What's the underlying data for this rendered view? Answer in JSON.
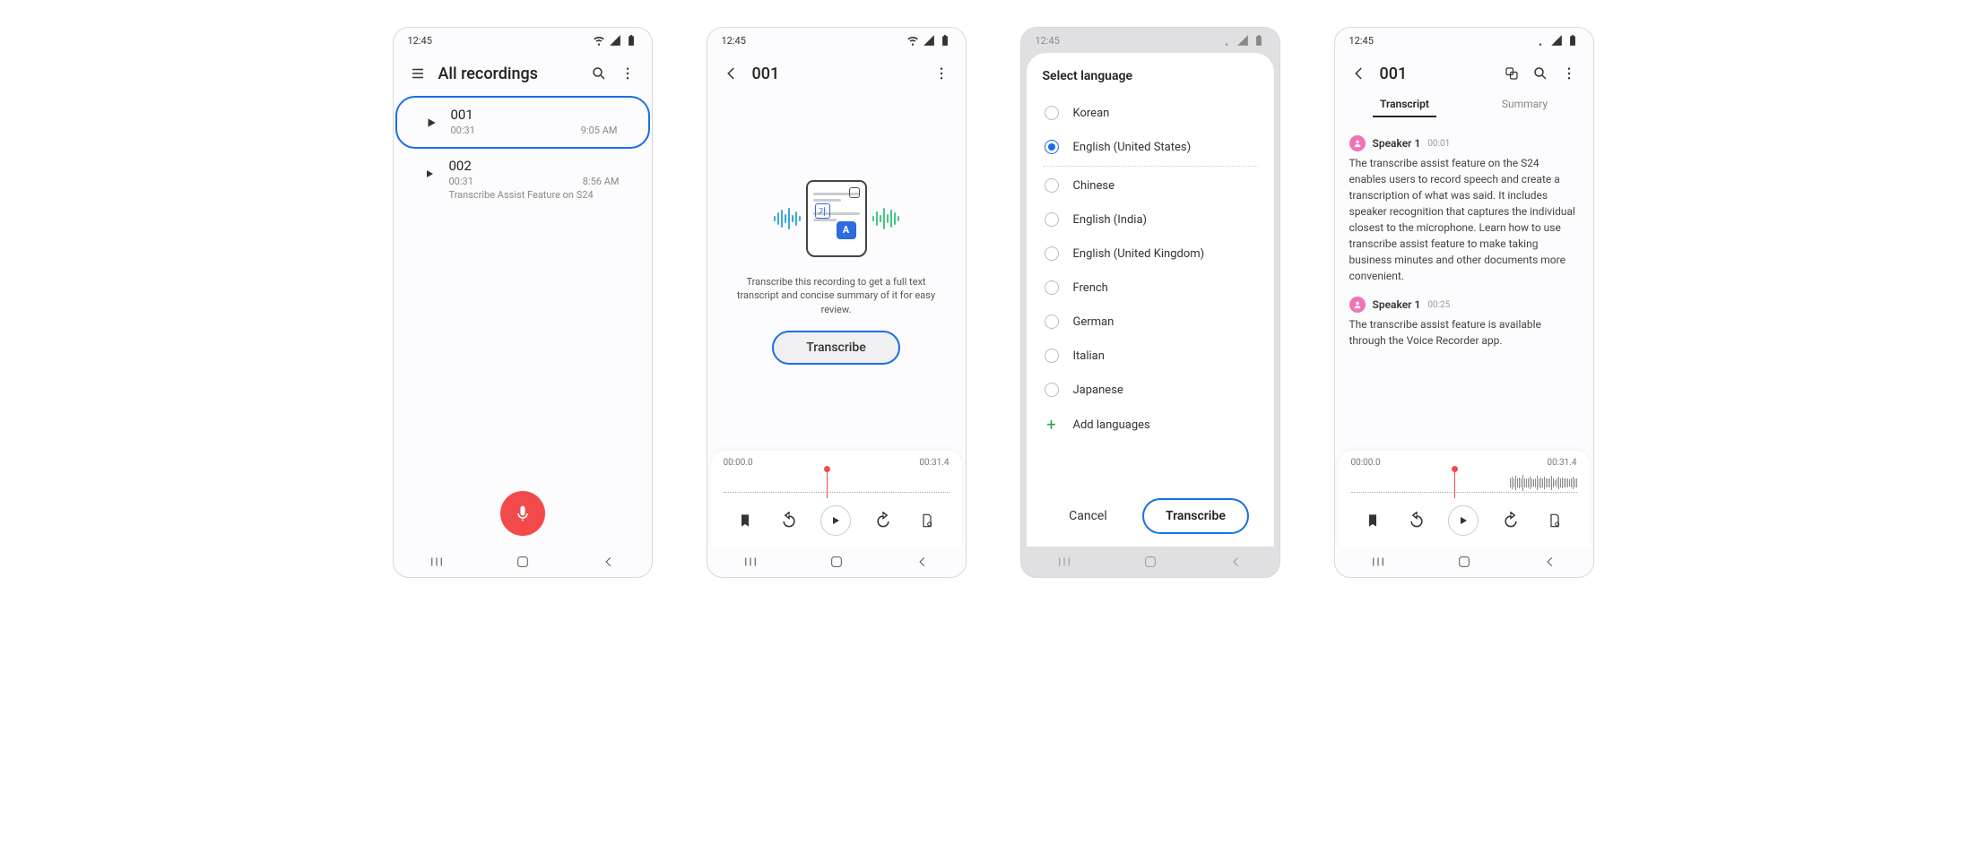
{
  "status": {
    "time": "12:45"
  },
  "screen1": {
    "title": "All recordings",
    "recordings": [
      {
        "name": "001",
        "duration": "00:31",
        "time": "9:05 AM",
        "note": ""
      },
      {
        "name": "002",
        "duration": "00:31",
        "time": "8:56 AM",
        "note": "Transcribe Assist Feature on S24"
      }
    ]
  },
  "screen2": {
    "title": "001",
    "promo_text": "Transcribe this recording to get a full text transcript and concise summary of it for easy review.",
    "button": "Transcribe",
    "time_start": "00:00.0",
    "time_end": "00:31.4"
  },
  "screen3": {
    "title": "Select language",
    "selected": "English (United States)",
    "languages_top": [
      "Korean"
    ],
    "languages": [
      "Chinese",
      "English (India)",
      "English (United Kingdom)",
      "French",
      "German",
      "Italian",
      "Japanese"
    ],
    "add": "Add languages",
    "cancel": "Cancel",
    "action": "Transcribe"
  },
  "screen4": {
    "title": "001",
    "tabs": {
      "transcript": "Transcript",
      "summary": "Summary"
    },
    "entries": [
      {
        "speaker": "Speaker 1",
        "time": "00:01",
        "text": "The transcribe assist feature on the S24 enables users to record speech and create a transcription of what was said. It includes speaker recognition that captures the individual closest to the microphone. Learn how to use transcribe assist feature to make taking business minutes and other documents more convenient."
      },
      {
        "speaker": "Speaker 1",
        "time": "00:25",
        "text": "The transcribe assist feature is available through the Voice Recorder app."
      }
    ],
    "time_start": "00:00.0",
    "time_end": "00:31.4"
  }
}
